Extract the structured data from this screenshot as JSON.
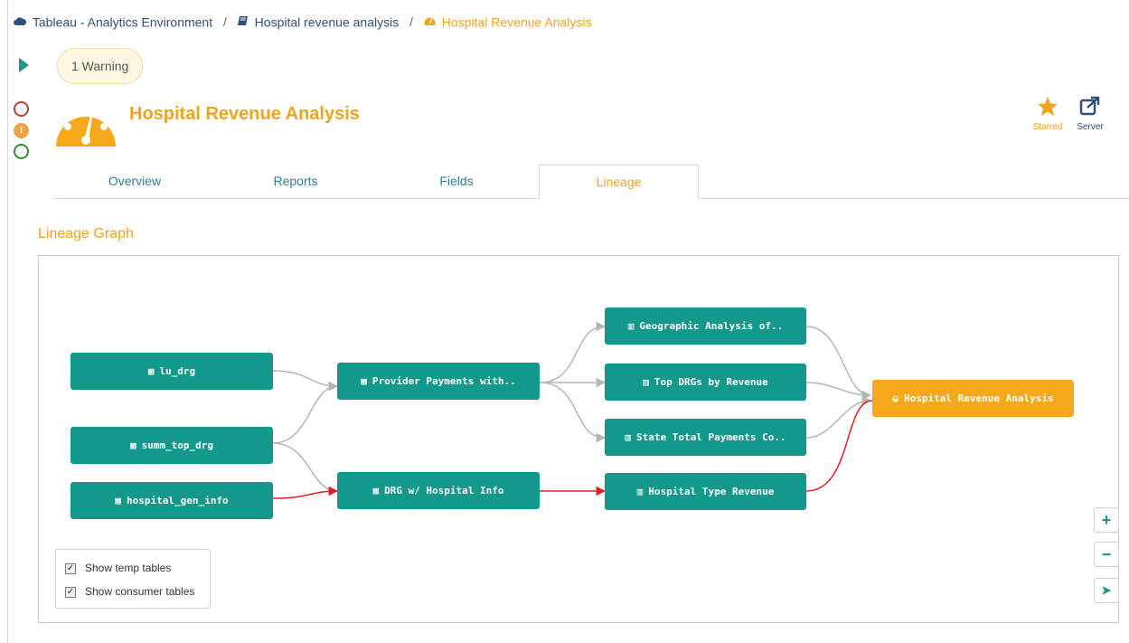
{
  "breadcrumb": {
    "items": [
      {
        "icon": "cloud-icon",
        "label": "Tableau - Analytics Environment"
      },
      {
        "icon": "book-icon",
        "label": "Hospital revenue analysis"
      },
      {
        "icon": "dashboard-icon",
        "label": "Hospital Revenue Analysis"
      }
    ],
    "separator": "/"
  },
  "warning_badge": "1 Warning",
  "page_title": "Hospital Revenue Analysis",
  "actions": {
    "starred_label": "Starred",
    "server_label": "Server"
  },
  "tabs": [
    {
      "label": "Overview",
      "active": false
    },
    {
      "label": "Reports",
      "active": false
    },
    {
      "label": "Fields",
      "active": false
    },
    {
      "label": "Lineage",
      "active": true
    }
  ],
  "section_title": "Lineage Graph",
  "graph": {
    "nodes": {
      "lu_drg": {
        "label": "lu_drg",
        "icon": "table-icon"
      },
      "summ_top_drg": {
        "label": "summ_top_drg",
        "icon": "table-icon"
      },
      "hospital_gen_info": {
        "label": "hospital_gen_info",
        "icon": "table-icon"
      },
      "provider_payments": {
        "label": "Provider Payments with..",
        "icon": "table-icon"
      },
      "drg_hospital_info": {
        "label": "DRG w/ Hospital Info",
        "icon": "table-icon"
      },
      "geographic_analysis": {
        "label": "Geographic Analysis of..",
        "icon": "chart-icon"
      },
      "top_drgs": {
        "label": "Top DRGs by Revenue",
        "icon": "chart-icon"
      },
      "state_total": {
        "label": "State Total Payments Co..",
        "icon": "chart-icon"
      },
      "hospital_type": {
        "label": "Hospital Type Revenue",
        "icon": "chart-icon"
      },
      "hospital_revenue": {
        "label": "Hospital Revenue Analysis",
        "icon": "dashboard-icon"
      }
    },
    "colors": {
      "node": "#13998b",
      "target": "#f6a81b",
      "edge": "#b5b5b5",
      "warning_edge": "#e0201b"
    }
  },
  "legend": {
    "show_temp_tables": {
      "label": "Show temp tables",
      "checked": true
    },
    "show_consumer_tables": {
      "label": "Show consumer tables",
      "checked": true
    }
  },
  "zoom": {
    "in": "+",
    "out": "−",
    "locate": "➤"
  }
}
